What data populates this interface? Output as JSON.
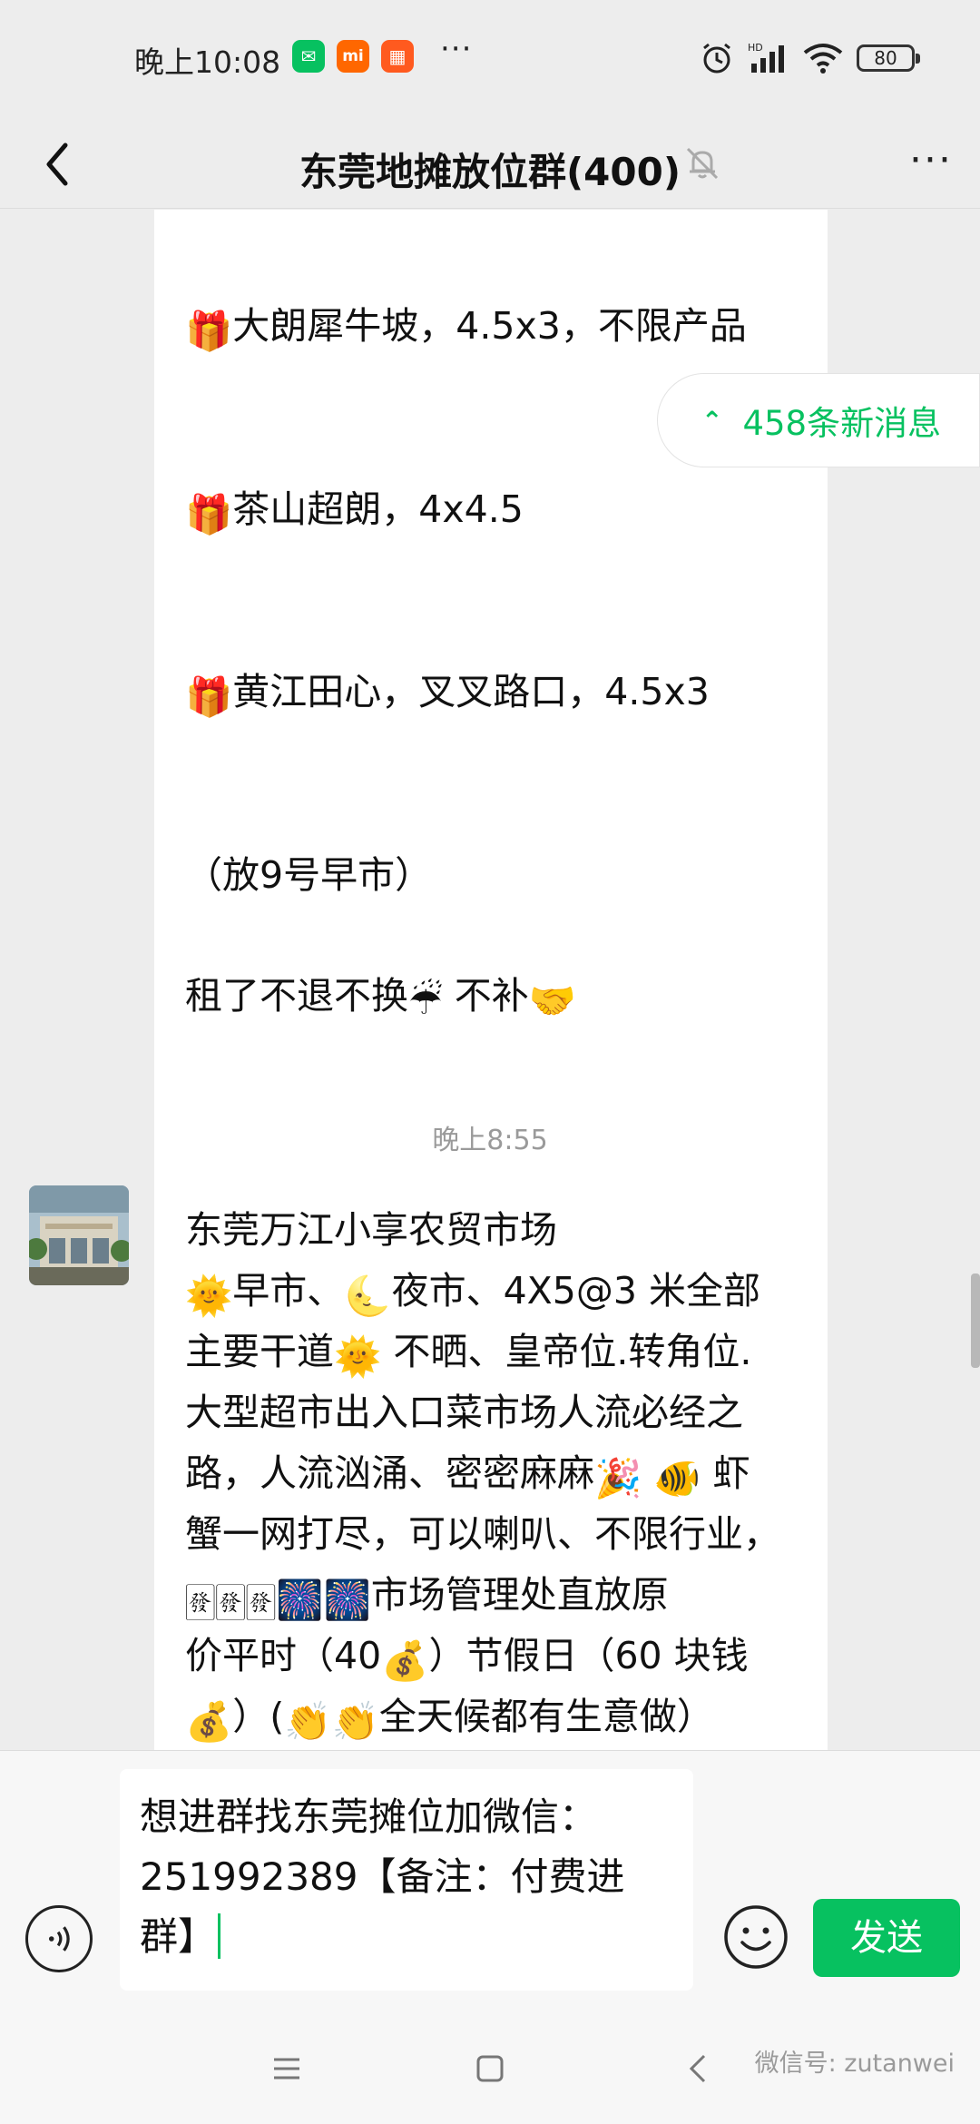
{
  "status_bar": {
    "time": "晚上10:08",
    "overflow": "···",
    "battery": "80",
    "icons": [
      "wechat-icon",
      "mi-icon",
      "app-icon",
      "alarm-icon",
      "hd-signal-icon",
      "wifi-icon",
      "battery-icon"
    ]
  },
  "header": {
    "title": "东莞地摊放位群(400)",
    "back_icon": "chevron-left-icon",
    "mute_icon": "bell-off-icon",
    "more": "···"
  },
  "messages": {
    "first": {
      "line1": "大朗犀牛坡，4.5x3，不限产品",
      "line2": "茶山超朗，4x4.5",
      "line3": "黄江田心，叉叉路口，4.5x3",
      "line4": "（放9号早市）",
      "line5a": "租了不退不换",
      "line5b": "不补"
    },
    "timestamp": "晚上8:55",
    "second": {
      "l1": "东莞万江小享农贸市场",
      "l2a": "早市、",
      "l2b": "夜市、4X5@3 米全部",
      "l3a": "主要干道",
      "l3b": " 不晒、皇帝位.转角位.",
      "l4": "大型超市出入口菜市场人流必经之",
      "l5": "路，人流汹涌、密密麻麻",
      "l5b": "虾",
      "l6": "蟹一网打尽，可以喇叭、不限行业，",
      "l7": "市场管理处直放原",
      "l8a": "价平时（40",
      "l8b": "）节假日（60 块钱",
      "l9a": "）(",
      "l9b": "全天候都有生意做）"
    }
  },
  "new_messages": "458条新消息",
  "input": {
    "line1": "想进群找东莞摊位加微信：",
    "line2": "251992389【备注：付费进",
    "line3": "群】"
  },
  "send_label": "发送",
  "watermark": "微信号: zutanwei",
  "colors": {
    "accent": "#07c160",
    "background": "#ededed",
    "bubble": "#ffffff"
  }
}
